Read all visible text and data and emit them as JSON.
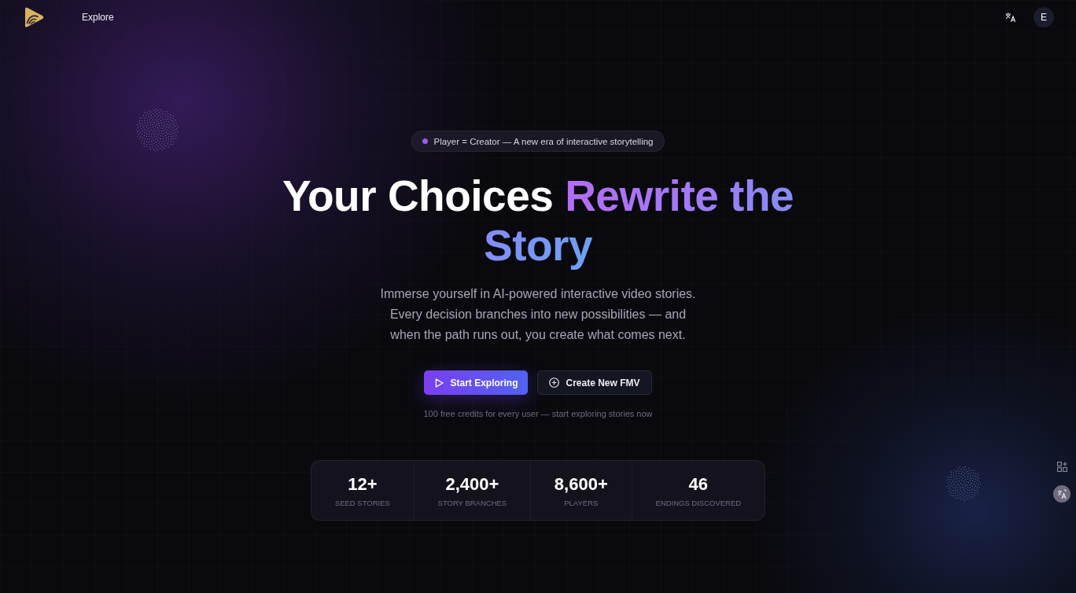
{
  "nav": {
    "links": [
      {
        "label": "Explore"
      }
    ],
    "avatar_initial": "E"
  },
  "hero": {
    "badge": "Player = Creator — A new era of interactive storytelling",
    "heading": "Your Choices",
    "heading_highlight": "Rewrite the Story",
    "subtitle": "Immerse yourself in AI-powered interactive video stories.\nEvery decision branches into new possibilities — and\nwhen the path runs out, you create what comes next.",
    "buttons": [
      {
        "label": "Start Exploring",
        "kind": "primary"
      },
      {
        "label": "Create New FMV",
        "kind": "secondary"
      }
    ],
    "note": "100 free credits for every user — start exploring stories now"
  },
  "stats": [
    {
      "value": "12+",
      "label": "SEED STORIES"
    },
    {
      "value": "2,400+",
      "label": "STORY BRANCHES"
    },
    {
      "value": "8,600+",
      "label": "PLAYERS"
    },
    {
      "value": "46",
      "label": "ENDINGS DISCOVERED"
    }
  ]
}
